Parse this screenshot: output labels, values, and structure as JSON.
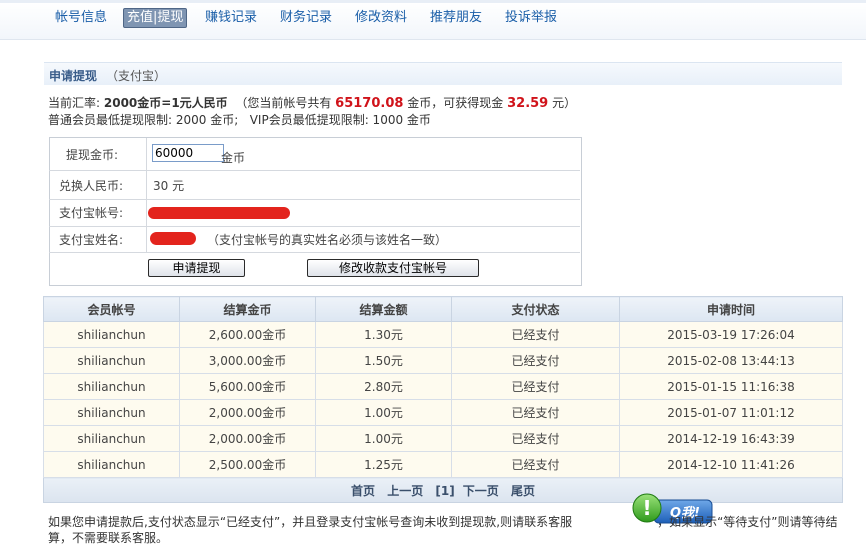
{
  "nav": {
    "items": [
      "帐号信息",
      "充值|提现",
      "赚钱记录",
      "财务记录",
      "修改资料",
      "推荐朋友",
      "投诉举报"
    ],
    "active_index": 1
  },
  "section": {
    "title": "申请提现",
    "subtitle": "（支付宝）"
  },
  "rate": {
    "prefix": "当前汇率:",
    "rate_text": "2000金币=1元人民币",
    "balance_prefix": "（您当前帐号共有",
    "balance": "65170.08",
    "balance_unit": "金币，可获得现金",
    "cash": "32.59",
    "cash_suffix": "元）"
  },
  "limits": {
    "normal": "普通会员最低提现限制: 2000 金币;",
    "vip": "VIP会员最低提现限制: 1000 金币"
  },
  "form": {
    "amount_label": "提现金币:",
    "amount_value": "60000",
    "amount_unit": "金币",
    "rmb_label": "兑换人民币:",
    "rmb_value": "30 元",
    "account_label": "支付宝帐号:",
    "name_label": "支付宝姓名:",
    "name_hint": "（支付宝帐号的真实姓名必须与该姓名一致）",
    "submit_label": "申请提现",
    "modify_label": "修改收款支付宝帐号"
  },
  "records": {
    "headers": [
      "会员帐号",
      "结算金币",
      "结算金额",
      "支付状态",
      "申请时间"
    ],
    "rows": [
      [
        "shilianchun",
        "2,600.00金币",
        "1.30元",
        "已经支付",
        "2015-03-19 17:26:04"
      ],
      [
        "shilianchun",
        "3,000.00金币",
        "1.50元",
        "已经支付",
        "2015-02-08 13:44:13"
      ],
      [
        "shilianchun",
        "5,600.00金币",
        "2.80元",
        "已经支付",
        "2015-01-15 11:16:38"
      ],
      [
        "shilianchun",
        "2,000.00金币",
        "1.00元",
        "已经支付",
        "2015-01-07 11:01:12"
      ],
      [
        "shilianchun",
        "2,000.00金币",
        "1.00元",
        "已经支付",
        "2014-12-19 16:43:39"
      ],
      [
        "shilianchun",
        "2,500.00金币",
        "1.25元",
        "已经支付",
        "2014-12-10 11:41:26"
      ]
    ],
    "pager": [
      "首页",
      "上一页",
      "[1]",
      "下一页",
      "尾页"
    ]
  },
  "notice": {
    "part1": "如果您申请提款后,支付状态显示“已经支付”，并且登录支付宝帐号查询未收到提现款,则请联系客服",
    "part2": "，如果显示“等待支付”则请等待结算，不需要联系客服。",
    "qq_label": "Q我!"
  },
  "colors": {
    "accent": "#1a5ea8",
    "highlight": "#d0131a",
    "redaction": "#e3241d"
  }
}
